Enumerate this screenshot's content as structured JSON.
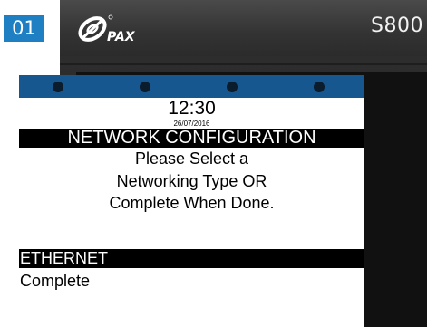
{
  "step_badge": "01",
  "terminal": {
    "brand": "PAX",
    "model": "S800",
    "status_bar_color": "#17578f",
    "accent_color": "#1f7fc3"
  },
  "screen": {
    "time": "12:30",
    "date": "26/07/2016",
    "title": "NETWORK CONFIGURATION",
    "instructions": [
      "Please Select a",
      "Networking Type OR",
      "Complete When Done."
    ],
    "options": [
      {
        "label": "ETHERNET",
        "selected": true
      },
      {
        "label": "Complete",
        "selected": false
      }
    ]
  }
}
